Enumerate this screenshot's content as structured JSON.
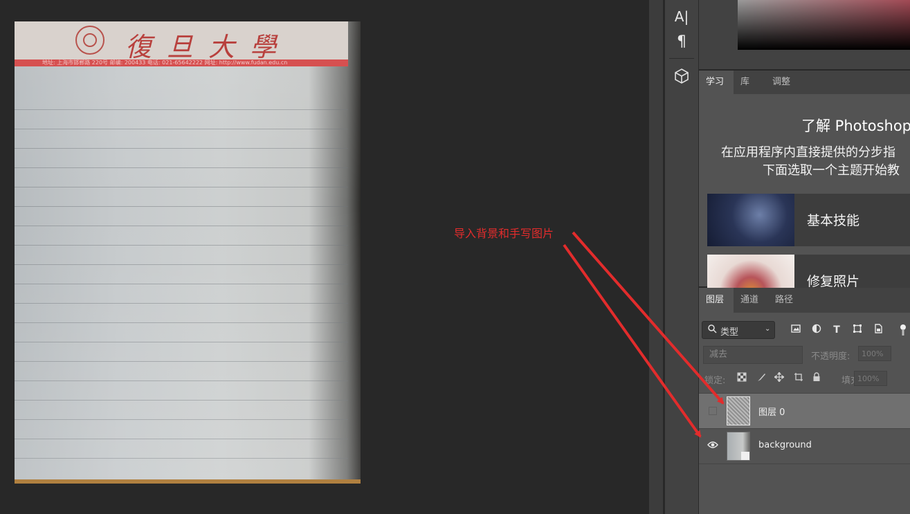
{
  "canvas": {
    "document": {
      "university_name": "復旦大學",
      "letterhead_address": "地址: 上海市邯郸路 220号     邮编: 200433     电话: 021-65642222     网址: http://www.fudan.edu.cn"
    },
    "annotation": {
      "text": "导入背景和手写图片",
      "color": "#e22c2c"
    }
  },
  "toolbar": {
    "icons": [
      "type-tool-icon",
      "paragraph-icon",
      "3d-cube-icon"
    ],
    "type_glyph": "A|",
    "paragraph_glyph": "¶"
  },
  "learn_panel": {
    "tabs": [
      "学习",
      "库",
      "调整"
    ],
    "active_tab": "学习",
    "title": "了解 Photoshop",
    "desc_line1": "在应用程序内直接提供的分步指",
    "desc_line2": "下面选取一个主题开始教",
    "cards": [
      {
        "label": "基本技能"
      },
      {
        "label": "修复照片"
      }
    ]
  },
  "layers_panel": {
    "tabs": [
      "图层",
      "通道",
      "路径"
    ],
    "active_tab": "图层",
    "filter": {
      "label": "类型",
      "icons": [
        "image-filter-icon",
        "adjustment-filter-icon",
        "type-filter-icon",
        "shape-filter-icon",
        "smart-object-filter-icon"
      ]
    },
    "blend_mode": "减去",
    "opacity_label": "不透明度:",
    "opacity_value": "100%",
    "lock_label": "锁定:",
    "fill_label": "填充:",
    "fill_value": "100%",
    "layers": [
      {
        "name": "图层 0",
        "visible": false,
        "selected": true
      },
      {
        "name": "background",
        "visible": true,
        "selected": false
      }
    ]
  },
  "colors": {
    "app_bg": "#282828",
    "panel_bg": "#535353",
    "accent_red": "#e22c2c"
  }
}
